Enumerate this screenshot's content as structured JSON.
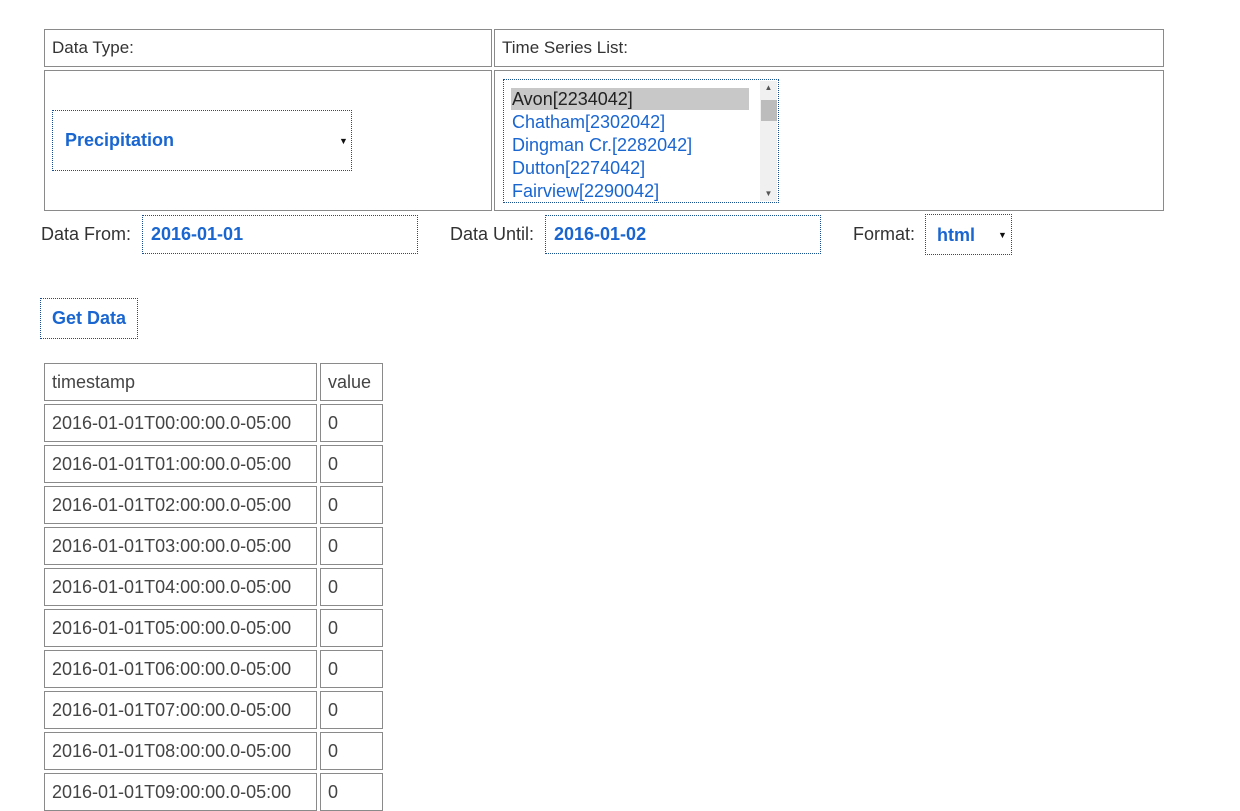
{
  "form": {
    "data_type_label": "Data Type:",
    "time_series_label": "Time Series List:",
    "data_type_value": "Precipitation",
    "time_series_options": [
      {
        "label": "Avon[2234042]",
        "selected": true
      },
      {
        "label": "Chatham[2302042]",
        "selected": false
      },
      {
        "label": "Dingman Cr.[2282042]",
        "selected": false
      },
      {
        "label": "Dutton[2274042]",
        "selected": false
      },
      {
        "label": "Fairview[2290042]",
        "selected": false
      }
    ],
    "from_label": "Data From:",
    "from_value": "2016-01-01",
    "until_label": "Data Until:",
    "until_value": "2016-01-02",
    "format_label": "Format:",
    "format_value": "html",
    "get_data_label": "Get Data"
  },
  "results": {
    "headers": [
      "timestamp",
      "value"
    ],
    "rows": [
      [
        "2016-01-01T00:00:00.0-05:00",
        "0"
      ],
      [
        "2016-01-01T01:00:00.0-05:00",
        "0"
      ],
      [
        "2016-01-01T02:00:00.0-05:00",
        "0"
      ],
      [
        "2016-01-01T03:00:00.0-05:00",
        "0"
      ],
      [
        "2016-01-01T04:00:00.0-05:00",
        "0"
      ],
      [
        "2016-01-01T05:00:00.0-05:00",
        "0"
      ],
      [
        "2016-01-01T06:00:00.0-05:00",
        "0"
      ],
      [
        "2016-01-01T07:00:00.0-05:00",
        "0"
      ],
      [
        "2016-01-01T08:00:00.0-05:00",
        "0"
      ],
      [
        "2016-01-01T09:00:00.0-05:00",
        "0"
      ]
    ]
  },
  "icons": {
    "dropdown_arrow": "triangle-down",
    "scroll_up": "triangle-up",
    "scroll_down": "triangle-down"
  },
  "colors": {
    "accent_text": "#1a66d1",
    "border": "#8a8a8a",
    "selected_option_bg": "#c8c8c8"
  }
}
